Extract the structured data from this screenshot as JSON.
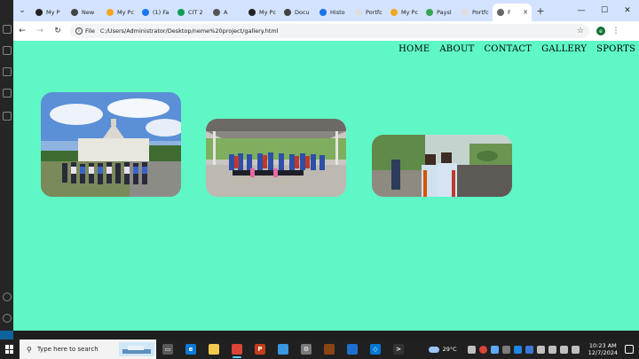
{
  "browser": {
    "tabs": [
      {
        "label": "My P",
        "color": "#222222"
      },
      {
        "label": "New",
        "color": "#444444"
      },
      {
        "label": "My Pc",
        "color": "#f5a623"
      },
      {
        "label": "(1) Fa",
        "color": "#1877f2"
      },
      {
        "label": "CIT 2",
        "color": "#0f9d58"
      },
      {
        "label": "A",
        "color": "#555555"
      },
      {
        "label": "My Pc",
        "color": "#222222"
      },
      {
        "label": "Docu",
        "color": "#444444"
      },
      {
        "label": "Histo",
        "color": "#1a73e8"
      },
      {
        "label": "Portfc",
        "color": "#dddddd"
      },
      {
        "label": "My Pc",
        "color": "#f5a623"
      },
      {
        "label": "Paysl",
        "color": "#34a853"
      },
      {
        "label": "Portfc",
        "color": "#dddddd"
      }
    ],
    "active_tab": {
      "label": "F",
      "color": "#666666"
    },
    "new_tab_label": "+",
    "url_scheme": "File",
    "url": "C:/Users/Administrator/Desktop/neme%20project/gallery.html",
    "profile_initial": "e"
  },
  "page": {
    "nav": [
      "HOME",
      "ABOUT",
      "CONTACT",
      "GALLERY",
      "SPORTS"
    ]
  },
  "taskbar": {
    "search_placeholder": "Type here to search",
    "apps": [
      {
        "name": "task-view",
        "color": "#5a5a5a",
        "glyph": "▭"
      },
      {
        "name": "edge",
        "color": "#0c7bd6",
        "glyph": "e"
      },
      {
        "name": "file-explorer",
        "color": "#f2c94c",
        "glyph": ""
      },
      {
        "name": "chrome",
        "color": "#db4437",
        "glyph": "",
        "active": true
      },
      {
        "name": "powerpoint",
        "color": "#c43e1c",
        "glyph": "P"
      },
      {
        "name": "notepad",
        "color": "#3a96dd",
        "glyph": ""
      },
      {
        "name": "settings",
        "color": "#7a7a7a",
        "glyph": "⚙"
      },
      {
        "name": "winrar",
        "color": "#8b4513",
        "glyph": ""
      },
      {
        "name": "photos",
        "color": "#1f6fd1",
        "glyph": ""
      },
      {
        "name": "vscode",
        "color": "#0078d4",
        "glyph": "◇"
      },
      {
        "name": "terminal",
        "color": "#333333",
        "glyph": ">"
      }
    ],
    "weather": "29°C",
    "time": "10:23 AM",
    "date": "12/7/2024"
  }
}
